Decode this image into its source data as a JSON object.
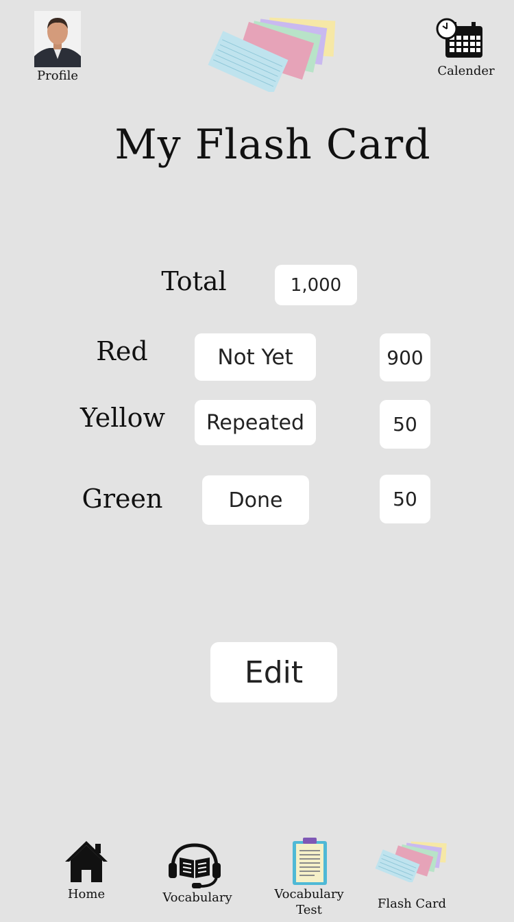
{
  "header": {
    "profile_label": "Profile",
    "calendar_label": "Calender",
    "title": "My Flash Card"
  },
  "stats": {
    "total": {
      "label": "Total",
      "value": "1,000"
    },
    "rows": [
      {
        "label": "Red",
        "status": "Not Yet",
        "count": "900"
      },
      {
        "label": "Yellow",
        "status": "Repeated",
        "count": "50"
      },
      {
        "label": "Green",
        "status": "Done",
        "count": "50"
      }
    ]
  },
  "edit_label": "Edit",
  "nav": [
    {
      "label": "Home",
      "icon": "home-icon"
    },
    {
      "label": "Vocabulary",
      "icon": "headset-book-icon"
    },
    {
      "label": "Vocabulary Test",
      "icon": "clipboard-icon"
    },
    {
      "label": "Flash Card",
      "icon": "flash-cards-icon"
    }
  ],
  "colors": {
    "background": "#e3e3e3",
    "box": "#ffffff",
    "card_blue": "#bfe3ee",
    "card_pink": "#e6a3b8",
    "card_green": "#b8e3c8",
    "card_purple": "#c9b9f0",
    "card_yellow": "#f6e8a6"
  }
}
